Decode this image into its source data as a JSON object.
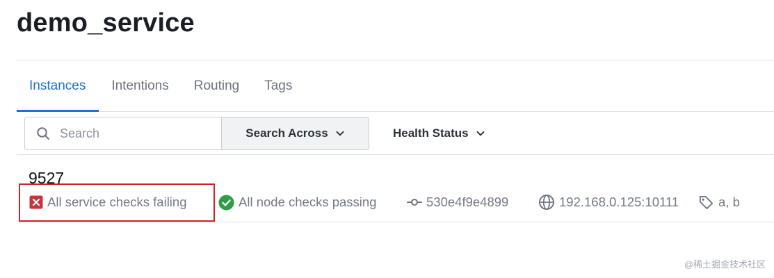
{
  "service": {
    "name": "demo_service"
  },
  "tabs": [
    {
      "label": "Instances",
      "active": true
    },
    {
      "label": "Intentions",
      "active": false
    },
    {
      "label": "Routing",
      "active": false
    },
    {
      "label": "Tags",
      "active": false
    }
  ],
  "toolbar": {
    "search_placeholder": "Search",
    "search_value": "",
    "search_across_label": "Search Across",
    "health_status_label": "Health Status"
  },
  "instances": [
    {
      "id": "9527",
      "service_checks": "All service checks failing",
      "node_checks": "All node checks passing",
      "node": "530e4f9e4899",
      "address": "192.168.0.125:10111",
      "tags": "a, b"
    }
  ],
  "watermark": "@稀土掘金技术社区",
  "colors": {
    "accent": "#1f6fd1",
    "failing": "#c8343c",
    "passing": "#2e9e45",
    "highlight_border": "#d0202a"
  },
  "icons": {
    "search": "search-icon",
    "chevron": "chevron-down-icon",
    "failing": "failing-x-icon",
    "passing": "passing-check-icon",
    "node": "git-commit-icon",
    "address": "globe-icon",
    "tags": "tag-icon"
  }
}
